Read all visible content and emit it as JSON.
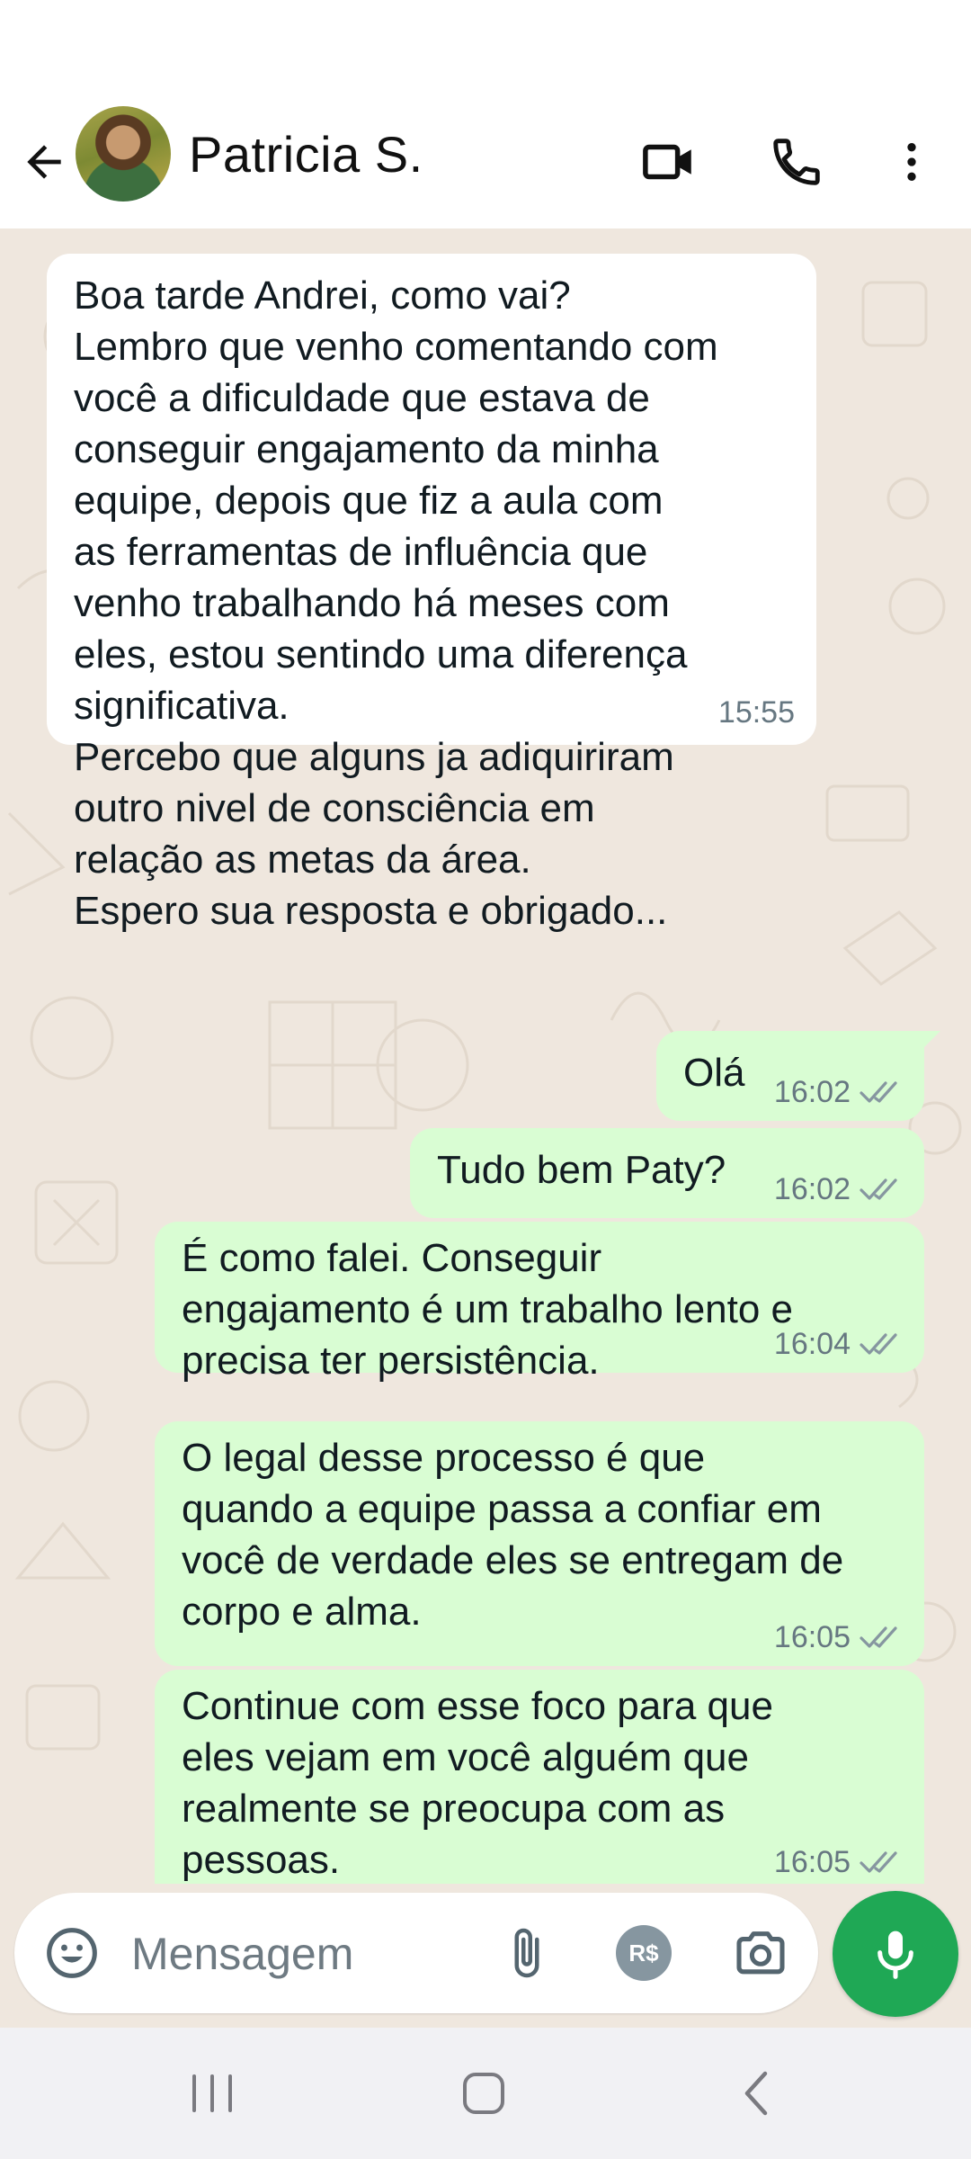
{
  "header": {
    "contact_name": "Patricia S."
  },
  "messages": [
    {
      "direction": "incoming",
      "text": "Boa tarde Andrei, como vai?\nLembro que venho comentando com\nvocê a dificuldade que estava de\nconseguir engajamento da minha\nequipe, depois que fiz a aula com\nas ferramentas de influência  que\nvenho trabalhando há meses com\neles, estou sentindo uma diferença\nsignificativa.\nPercebo que alguns ja adiquiriram\noutro nivel de consciência em\nrelação as metas da área.\nEspero sua resposta e obrigado...",
      "time": "15:55"
    },
    {
      "direction": "outgoing",
      "text": "Olá",
      "time": "16:02",
      "status": "read"
    },
    {
      "direction": "outgoing",
      "text": "Tudo bem Paty?",
      "time": "16:02",
      "status": "read"
    },
    {
      "direction": "outgoing",
      "text": "É como falei. Conseguir\nengajamento é um trabalho lento e\nprecisa ter persistência.",
      "time": "16:04",
      "status": "read"
    },
    {
      "direction": "outgoing",
      "text": "O legal desse processo é que\nquando a equipe passa a confiar em\nvocê de verdade eles se entregam de\ncorpo e alma.",
      "time": "16:05",
      "status": "read"
    },
    {
      "direction": "outgoing",
      "text": "Continue com esse foco para que\neles vejam em você alguém que\nrealmente se preocupa com as\npessoas.",
      "time": "16:05",
      "status": "read"
    }
  ],
  "input": {
    "placeholder": "Mensagem",
    "value": "",
    "payment_label": "R$"
  },
  "icons": {
    "back": "arrow-left-icon",
    "video": "video-camera-icon",
    "call": "phone-icon",
    "menu": "more-vertical-icon",
    "emoji": "smiley-icon",
    "attach": "paperclip-icon",
    "camera": "camera-icon",
    "mic": "microphone-icon",
    "read_receipt": "double-check-icon"
  },
  "colors": {
    "chat_background": "#efe7de",
    "incoming_bubble": "#ffffff",
    "outgoing_bubble": "#d9fdd3",
    "accent_green": "#1fa855",
    "meta_gray": "#667781"
  }
}
